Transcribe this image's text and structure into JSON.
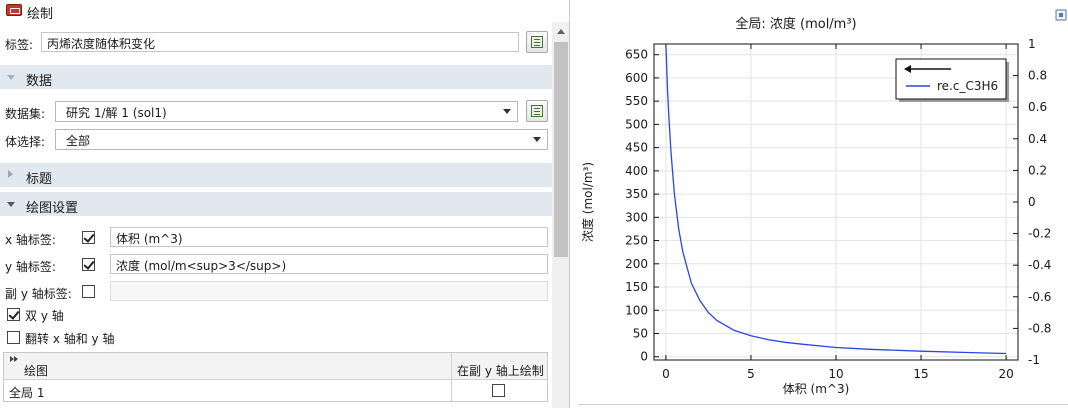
{
  "window": {
    "title": "绘制"
  },
  "label_row": {
    "label": "标签:",
    "value": "丙烯浓度随体积变化"
  },
  "sections": {
    "data": "数据",
    "title": "标题",
    "plot_settings": "绘图设置"
  },
  "data_section": {
    "dataset_label": "数据集:",
    "dataset_value": "研究 1/解 1 (sol1)",
    "selection_label": "体选择:",
    "selection_value": "全部"
  },
  "plot_settings": {
    "x_label_caption": "x 轴标签:",
    "x_label_checked": true,
    "x_label_value": "体积 (m^3)",
    "y_label_caption": "y 轴标签:",
    "y_label_checked": true,
    "y_label_value": "浓度 (mol/m<sup>3</sup>)",
    "y2_label_caption": "副 y 轴标签:",
    "y2_label_checked": false,
    "y2_label_value": "",
    "dual_y_caption": "双 y 轴",
    "dual_y_checked": true,
    "flip_caption": "翻转 x 轴和 y 轴",
    "flip_checked": false
  },
  "table": {
    "headers": [
      "绘图",
      "在副 y 轴上绘制"
    ],
    "rows": [
      {
        "name": "全局 1",
        "on_secondary": false
      }
    ]
  },
  "colors": {
    "series": "#2b46e0",
    "section_bg": "#e2e8f0"
  },
  "chart_data": {
    "type": "line",
    "title": "全局: 浓度 (mol/m³)",
    "xlabel": "体积 (m^3)",
    "ylabel": "浓度 (mol/m³)",
    "xlim": [
      -0.7,
      20.7
    ],
    "ylim": [
      -7,
      673
    ],
    "x_ticks": [
      0,
      5,
      10,
      15,
      20
    ],
    "y_ticks": [
      0,
      50,
      100,
      150,
      200,
      250,
      300,
      350,
      400,
      450,
      500,
      550,
      600,
      650
    ],
    "y2lim": [
      -1,
      1
    ],
    "y2_ticks": [
      -1,
      -0.8,
      -0.6,
      -0.4,
      -0.2,
      0,
      0.2,
      0.4,
      0.6,
      0.8,
      1
    ],
    "grid": true,
    "legend_position": "top-right",
    "series": [
      {
        "name": "re.c_C3H6",
        "x": [
          0,
          0.1,
          0.2,
          0.3,
          0.5,
          0.75,
          1,
          1.5,
          2,
          2.5,
          3,
          4,
          5,
          6,
          7,
          8,
          10,
          12,
          15,
          18,
          20
        ],
        "y": [
          672,
          570,
          500,
          440,
          350,
          275,
          225,
          158,
          121,
          95,
          78,
          57,
          45,
          37,
          31,
          27,
          20,
          16,
          12,
          9,
          7
        ]
      }
    ]
  }
}
